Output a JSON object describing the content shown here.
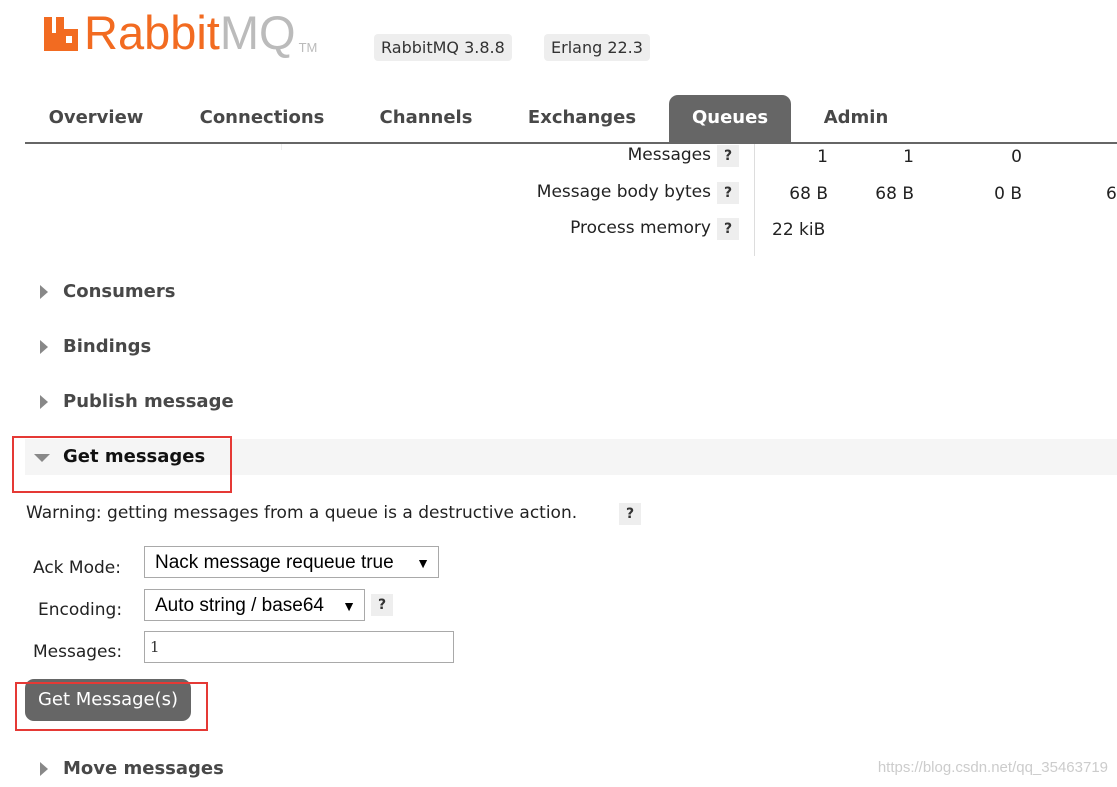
{
  "header": {
    "logo_text_rabbit": "Rabbit",
    "logo_text_mq": "MQ",
    "logo_tm": "TM",
    "rabbitmq_version": "RabbitMQ 3.8.8",
    "erlang_version": "Erlang 22.3",
    "brand_color": "#f26b21"
  },
  "nav": {
    "tabs": [
      {
        "label": "Overview"
      },
      {
        "label": "Connections"
      },
      {
        "label": "Channels"
      },
      {
        "label": "Exchanges"
      },
      {
        "label": "Queues"
      },
      {
        "label": "Admin"
      }
    ],
    "active_tab": "Queues"
  },
  "stats": {
    "rows": [
      {
        "label": "Messages",
        "values": [
          "1",
          "1",
          "0"
        ]
      },
      {
        "label": "Message body bytes",
        "values": [
          "68 B",
          "68 B",
          "0 B",
          "6"
        ]
      },
      {
        "label": "Process memory",
        "values": [
          "22 kiB"
        ]
      }
    ],
    "help_glyph": "?"
  },
  "sections": {
    "consumers": "Consumers",
    "bindings": "Bindings",
    "publish_message": "Publish message",
    "get_messages": "Get messages",
    "move_messages": "Move messages"
  },
  "get_messages": {
    "warning": "Warning: getting messages from a queue is a destructive action.",
    "ack_mode_label": "Ack Mode:",
    "ack_mode_value": "Nack message requeue true",
    "encoding_label": "Encoding:",
    "encoding_value": "Auto string / base64",
    "messages_label": "Messages:",
    "messages_value": "1",
    "button_label": "Get Message(s)"
  },
  "watermark": "https://blog.csdn.net/qq_35463719"
}
